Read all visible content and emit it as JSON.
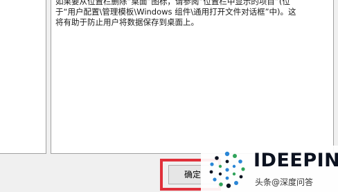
{
  "help_text": {
    "line1": "如果要从位置栏删除“桌面”图标，请参阅“位置栏中显示的项目”(位",
    "line2": "于“用户配置\\管理模板\\Windows 组件\\通用打开文件对话框”中)。这",
    "line3": "将有助于防止用户将数据保存到桌面上。"
  },
  "buttons": {
    "ok_label": "确定"
  },
  "watermark": {
    "brand": "IDEEPIN",
    "source": "头条@深度问答"
  },
  "colors": {
    "highlight": "#e0303a",
    "logo_blue": "#2a86d6",
    "logo_green": "#2fa35a",
    "logo_dark": "#0c1220"
  }
}
